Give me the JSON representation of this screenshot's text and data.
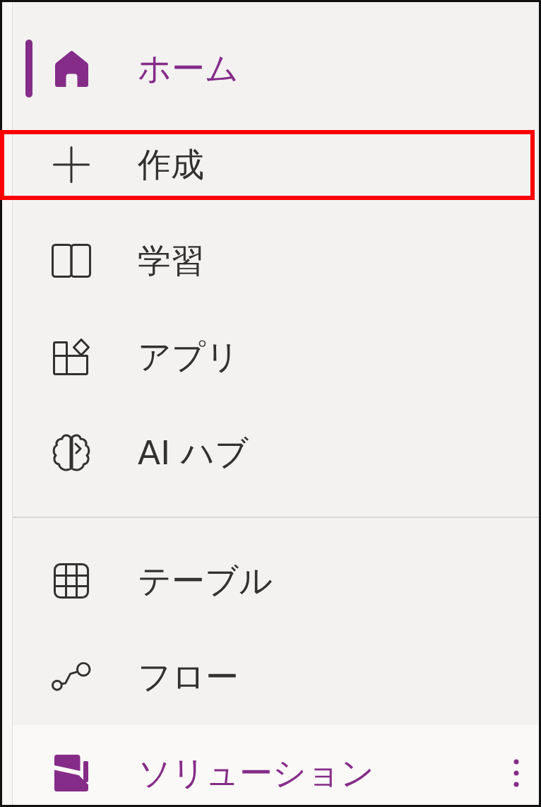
{
  "nav": {
    "groups": [
      {
        "items": [
          {
            "label": "ホーム",
            "selected": true,
            "hovered": false,
            "highlighted": false
          },
          {
            "label": "作成",
            "selected": false,
            "hovered": false,
            "highlighted": true
          },
          {
            "label": "学習",
            "selected": false,
            "hovered": false,
            "highlighted": false
          },
          {
            "label": "アプリ",
            "selected": false,
            "hovered": false,
            "highlighted": false
          },
          {
            "label": "AI ハブ",
            "selected": false,
            "hovered": false,
            "highlighted": false
          }
        ]
      },
      {
        "items": [
          {
            "label": "テーブル",
            "selected": false,
            "hovered": false,
            "highlighted": false
          },
          {
            "label": "フロー",
            "selected": false,
            "hovered": false,
            "highlighted": false
          },
          {
            "label": "ソリューション",
            "selected": false,
            "hovered": true,
            "highlighted": false
          }
        ]
      }
    ]
  }
}
